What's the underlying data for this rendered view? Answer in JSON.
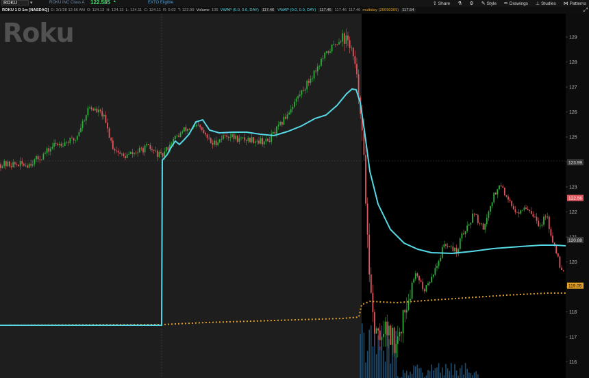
{
  "toolbar": {
    "symbol": "ROKU",
    "company": "ROKU INC Class A",
    "last_price": "122.585",
    "change_top": "▲",
    "change_bottom": "",
    "exto": "EXTO Eligible",
    "items": [
      {
        "icon": "share-icon",
        "label": "Share"
      },
      {
        "icon": "flask-icon",
        "label": ""
      },
      {
        "icon": "gear-icon",
        "label": ""
      },
      {
        "icon": "style-icon",
        "label": "Style"
      },
      {
        "icon": "pencil-icon",
        "label": "Drawings"
      },
      {
        "icon": "studies-icon",
        "label": "Studies"
      },
      {
        "icon": "patterns-icon",
        "label": "Patterns"
      }
    ]
  },
  "legend": {
    "title": "ROKU 1 D 1m [NASDAQ]",
    "date": "D: 3/1/28 12:56 AM",
    "open": "O: 124.13",
    "high": "H: 124.13",
    "low": "L: 124.11",
    "close": "C: 124.11",
    "range": "R: 0.02",
    "typ": "T: 123.99",
    "volume_label": "Volume",
    "volume_value": "105",
    "vwap1_label": "VWAP (0.0, 0.0, DAY)",
    "vwap1_value": "117.46",
    "vwap2_label": "VWAP (0.0, 0.0, DAY)",
    "vwap2_value": "117.46",
    "vwap2_box": "117.46",
    "vwap2_box2": "117.46",
    "ma_label": "multiday (20090309)",
    "ma_value": "117.54"
  },
  "watermark": "Roku",
  "colors": {
    "up": "#2fae3c",
    "down": "#e0585e",
    "vwap": "#56d9e6",
    "ma": "#e3a12a",
    "session_bg": "#1e1e1e",
    "ext_bg": "#000000"
  },
  "axis": {
    "ticks": [
      "129",
      "128",
      "127",
      "126",
      "125",
      "124",
      "123",
      "122",
      "121",
      "120",
      "119",
      "118",
      "117",
      "116"
    ],
    "markers": [
      {
        "value": "123.99",
        "label": "123.99",
        "color": "#3a3a3a",
        "text": "#e0e0e0"
      },
      {
        "value": "122.56",
        "label": "122.56",
        "color": "#e0585e",
        "text": "#ffffff"
      },
      {
        "value": "120.88",
        "label": "120.88",
        "color": "#3a3a3a",
        "text": "#e0e0e0"
      },
      {
        "value": "119.05",
        "label": "119.05",
        "color": "#e3a12a",
        "text": "#000000"
      }
    ]
  }
}
